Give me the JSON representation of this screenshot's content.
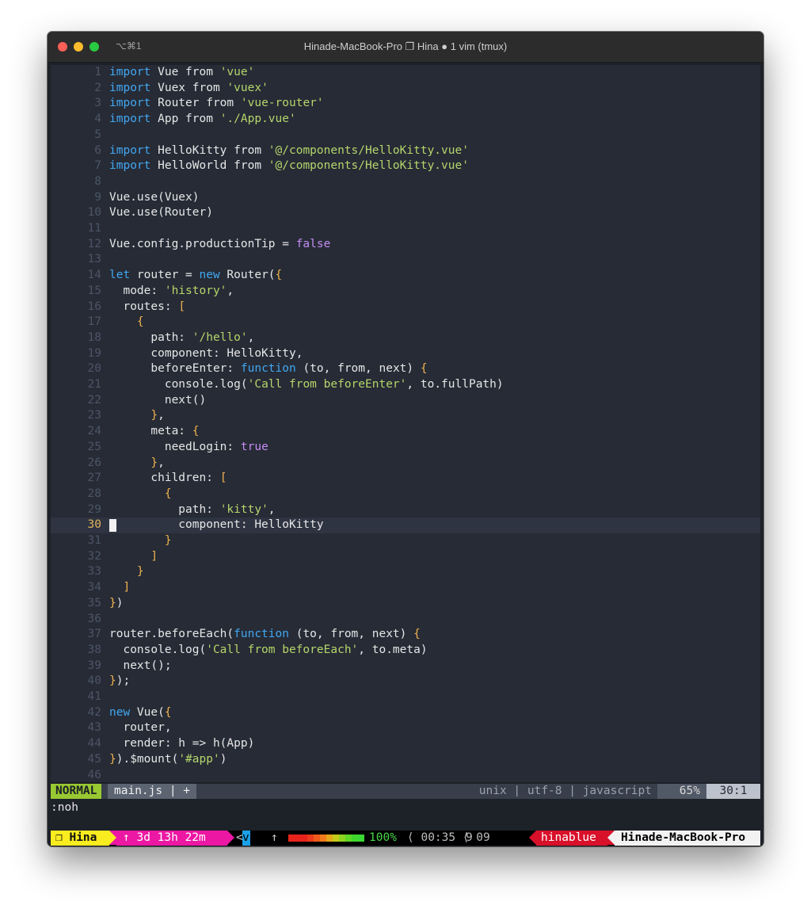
{
  "window": {
    "shortcut": "⌥⌘1",
    "title": "Hinade-MacBook-Pro ❐ Hina ● 1 vim (tmux)"
  },
  "editor": {
    "current_line": 30,
    "lines": [
      {
        "n": "1",
        "tokens": [
          [
            "kw",
            "import"
          ],
          [
            "",
            "Vue from "
          ],
          [
            "st",
            "'vue'"
          ]
        ]
      },
      {
        "n": "2",
        "tokens": [
          [
            "kw",
            "import"
          ],
          [
            "",
            "Vuex from "
          ],
          [
            "st",
            "'vuex'"
          ]
        ]
      },
      {
        "n": "3",
        "tokens": [
          [
            "kw",
            "import"
          ],
          [
            "",
            "Router from "
          ],
          [
            "st",
            "'vue-router'"
          ]
        ]
      },
      {
        "n": "4",
        "tokens": [
          [
            "kw",
            "import"
          ],
          [
            "",
            "App from "
          ],
          [
            "st",
            "'./App.vue'"
          ]
        ]
      },
      {
        "n": "5",
        "tokens": []
      },
      {
        "n": "6",
        "tokens": [
          [
            "kw",
            "import"
          ],
          [
            "",
            "HelloKitty from "
          ],
          [
            "st",
            "'@/components/HelloKitty.vue'"
          ]
        ]
      },
      {
        "n": "7",
        "tokens": [
          [
            "kw",
            "import"
          ],
          [
            "",
            "HelloWorld from "
          ],
          [
            "st",
            "'@/components/HelloKitty.vue'"
          ]
        ]
      },
      {
        "n": "8",
        "tokens": []
      },
      {
        "n": "9",
        "tokens": [
          [
            "",
            "Vue.use(Vuex)"
          ]
        ]
      },
      {
        "n": "10",
        "tokens": [
          [
            "",
            "Vue.use(Router)"
          ]
        ]
      },
      {
        "n": "11",
        "tokens": []
      },
      {
        "n": "12",
        "tokens": [
          [
            "",
            "Vue.config.productionTip = "
          ],
          [
            "bl",
            "false"
          ]
        ]
      },
      {
        "n": "13",
        "tokens": []
      },
      {
        "n": "14",
        "tokens": [
          [
            "kw",
            "let"
          ],
          [
            "",
            "router = "
          ],
          [
            "kw",
            "new"
          ],
          [
            "",
            "Router("
          ],
          [
            "br",
            "{"
          ]
        ]
      },
      {
        "n": "15",
        "tokens": [
          [
            "",
            "  mode: "
          ],
          [
            "st",
            "'history'"
          ],
          [
            "",
            ","
          ]
        ]
      },
      {
        "n": "16",
        "tokens": [
          [
            "",
            "  routes: "
          ],
          [
            "br",
            "["
          ]
        ]
      },
      {
        "n": "17",
        "tokens": [
          [
            "",
            "    "
          ],
          [
            "br",
            "{"
          ]
        ]
      },
      {
        "n": "18",
        "tokens": [
          [
            "",
            "      path: "
          ],
          [
            "st",
            "'/hello'"
          ],
          [
            "",
            ","
          ]
        ]
      },
      {
        "n": "19",
        "tokens": [
          [
            "",
            "      component: HelloKitty,"
          ]
        ]
      },
      {
        "n": "20",
        "tokens": [
          [
            "",
            "      beforeEnter: "
          ],
          [
            "kw",
            "function"
          ],
          [
            "",
            "(to, from, next) "
          ],
          [
            "br",
            "{"
          ]
        ]
      },
      {
        "n": "21",
        "tokens": [
          [
            "",
            "        console.log("
          ],
          [
            "st",
            "'Call from beforeEnter'"
          ],
          [
            "",
            ", to.fullPath)"
          ]
        ]
      },
      {
        "n": "22",
        "tokens": [
          [
            "",
            "        next()"
          ]
        ]
      },
      {
        "n": "23",
        "tokens": [
          [
            "",
            "      "
          ],
          [
            "br",
            "}"
          ],
          [
            "",
            ","
          ]
        ]
      },
      {
        "n": "24",
        "tokens": [
          [
            "",
            "      meta: "
          ],
          [
            "br",
            "{"
          ]
        ]
      },
      {
        "n": "25",
        "tokens": [
          [
            "",
            "        needLogin: "
          ],
          [
            "bl",
            "true"
          ]
        ]
      },
      {
        "n": "26",
        "tokens": [
          [
            "",
            "      "
          ],
          [
            "br",
            "}"
          ],
          [
            "",
            ","
          ]
        ]
      },
      {
        "n": "27",
        "tokens": [
          [
            "",
            "      children: "
          ],
          [
            "br",
            "["
          ]
        ]
      },
      {
        "n": "28",
        "tokens": [
          [
            "",
            "        "
          ],
          [
            "br",
            "{"
          ]
        ]
      },
      {
        "n": "29",
        "tokens": [
          [
            "",
            "          path: "
          ],
          [
            "st",
            "'kitty'"
          ],
          [
            "",
            ","
          ]
        ]
      },
      {
        "n": "30",
        "tokens": [
          [
            "",
            "          component: HelloKitty"
          ]
        ]
      },
      {
        "n": "31",
        "tokens": [
          [
            "",
            "        "
          ],
          [
            "br",
            "}"
          ]
        ]
      },
      {
        "n": "32",
        "tokens": [
          [
            "",
            "      "
          ],
          [
            "br",
            "]"
          ]
        ]
      },
      {
        "n": "33",
        "tokens": [
          [
            "",
            "    "
          ],
          [
            "br",
            "}"
          ]
        ]
      },
      {
        "n": "34",
        "tokens": [
          [
            "",
            "  "
          ],
          [
            "br",
            "]"
          ]
        ]
      },
      {
        "n": "35",
        "tokens": [
          [
            "br",
            "}"
          ],
          [
            "",
            ")"
          ]
        ]
      },
      {
        "n": "36",
        "tokens": []
      },
      {
        "n": "37",
        "tokens": [
          [
            "",
            "router.beforeEach("
          ],
          [
            "kw",
            "function"
          ],
          [
            "",
            "(to, from, next) "
          ],
          [
            "br",
            "{"
          ]
        ]
      },
      {
        "n": "38",
        "tokens": [
          [
            "",
            "  console.log("
          ],
          [
            "st",
            "'Call from beforeEach'"
          ],
          [
            "",
            ", to.meta)"
          ]
        ]
      },
      {
        "n": "39",
        "tokens": [
          [
            "",
            "  next();"
          ]
        ]
      },
      {
        "n": "40",
        "tokens": [
          [
            "br",
            "}"
          ],
          [
            "",
            ");"
          ]
        ]
      },
      {
        "n": "41",
        "tokens": []
      },
      {
        "n": "42",
        "tokens": [
          [
            "kw",
            "new"
          ],
          [
            "",
            "Vue("
          ],
          [
            "br",
            "{"
          ]
        ]
      },
      {
        "n": "43",
        "tokens": [
          [
            "",
            "  router,"
          ]
        ]
      },
      {
        "n": "44",
        "tokens": [
          [
            "",
            "  render: h => h(App)"
          ]
        ]
      },
      {
        "n": "45",
        "tokens": [
          [
            "br",
            "}"
          ],
          [
            "",
            ").$mount("
          ],
          [
            "st",
            "'#app'"
          ],
          [
            "",
            ")"
          ]
        ]
      },
      {
        "n": "46",
        "tokens": []
      }
    ]
  },
  "statusline": {
    "mode": "NORMAL",
    "file": "main.js | +",
    "fileinfo": "unix | utf-8 | javascript",
    "percent": "65%",
    "position": "30:1"
  },
  "cmdline": ":noh",
  "tmux": {
    "session": "❐ Hina",
    "uptime": "↑ 3d 13h 22m",
    "lt": "<",
    "vim_indicator": "v",
    "battery_arrow": "↑",
    "battery_percent": "100%",
    "battery_level": 1.0,
    "clock": "⟨ 00:35 ⟨ 09",
    "date": "9",
    "user": "hinablue",
    "host": "Hinade-MacBook-Pro",
    "colors": {
      "session_bg": "#f9ec1f",
      "uptime_bg": "#ec17a3",
      "user_bg": "#d9102a",
      "host_bg": "#f2f2f2",
      "battery_text": "#48d84a"
    }
  }
}
